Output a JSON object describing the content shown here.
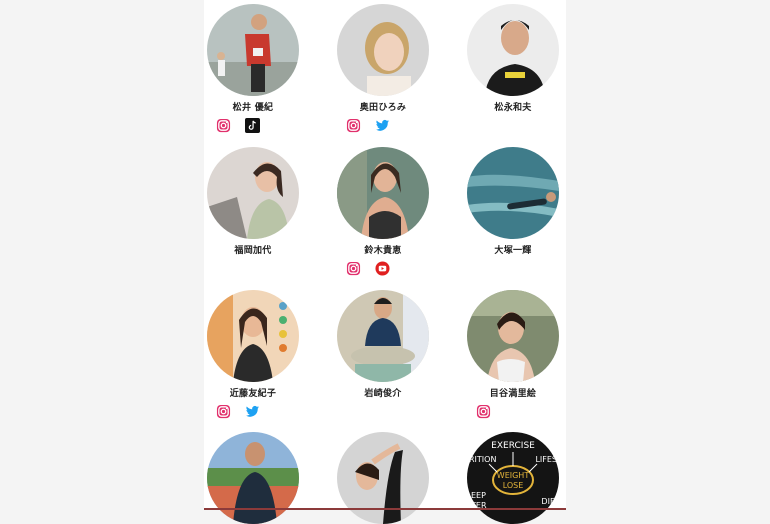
{
  "members": [
    {
      "name": "松井 優紀",
      "socials": [
        "instagram-icon",
        "tiktok-icon"
      ],
      "photo_colors": [
        "#9aa6a8",
        "#c7d0c6"
      ]
    },
    {
      "name": "奥田ひろみ",
      "socials": [
        "instagram-icon",
        "twitter-icon"
      ],
      "photo_colors": [
        "#b7b7b7",
        "#e6e6e6"
      ]
    },
    {
      "name": "松永和夫",
      "socials": [],
      "photo_colors": [
        "#eaeaea",
        "#1b1b1b"
      ]
    },
    {
      "name": "福岡加代",
      "socials": [],
      "photo_colors": [
        "#d9d3cf",
        "#b9c4a7"
      ]
    },
    {
      "name": "鈴木貴恵",
      "socials": [
        "instagram-icon",
        "youtube-icon"
      ],
      "photo_colors": [
        "#6f8a7d",
        "#3a3a3a"
      ]
    },
    {
      "name": "大塚一輝",
      "socials": [],
      "photo_colors": [
        "#3f7c8a",
        "#6fa9b3"
      ]
    },
    {
      "name": "近藤友紀子",
      "socials": [
        "instagram-icon",
        "twitter-icon"
      ],
      "photo_colors": [
        "#e7a35f",
        "#2a2a2a"
      ]
    },
    {
      "name": "岩崎俊介",
      "socials": [],
      "photo_colors": [
        "#c9c1ad",
        "#1f3a5c"
      ]
    },
    {
      "name": "目谷満里絵",
      "socials": [
        "instagram-icon"
      ],
      "photo_colors": [
        "#7f8b6f",
        "#e8e4e0"
      ]
    },
    {
      "name": "",
      "socials": [],
      "photo_colors": [
        "#8fb4d9",
        "#d46a4a"
      ]
    },
    {
      "name": "",
      "socials": [],
      "photo_colors": [
        "#bfbfbf",
        "#1a1a1a"
      ]
    },
    {
      "name": "",
      "socials": [],
      "photo_colors": [
        "#111111",
        "#e3b43a"
      ]
    }
  ],
  "weight_lose_graphic": {
    "top": "EXERCISE",
    "left": "RITION",
    "right": "LIFES",
    "center_line1": "WEIGHT",
    "center_line2": "LOSE",
    "bottom_left_1": "EEP",
    "bottom_left_2": "TER",
    "bottom_right": "DIE"
  }
}
